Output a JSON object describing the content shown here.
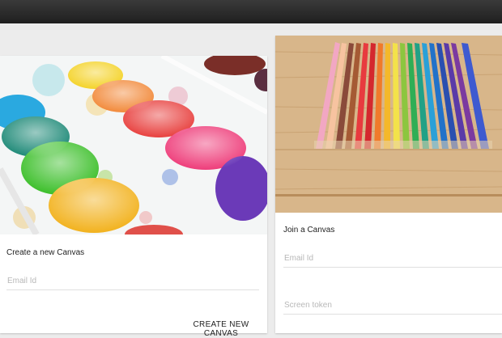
{
  "create_card": {
    "title": "Create a new Canvas",
    "email_placeholder": "Email Id",
    "button_label": "CREATE NEW CANVAS"
  },
  "join_card": {
    "title": "Join a Canvas",
    "email_placeholder": "Email Id",
    "token_placeholder": "Screen token"
  },
  "colors": {
    "topbar": "#2a2a2a",
    "background": "#ececec",
    "card": "#ffffff"
  }
}
